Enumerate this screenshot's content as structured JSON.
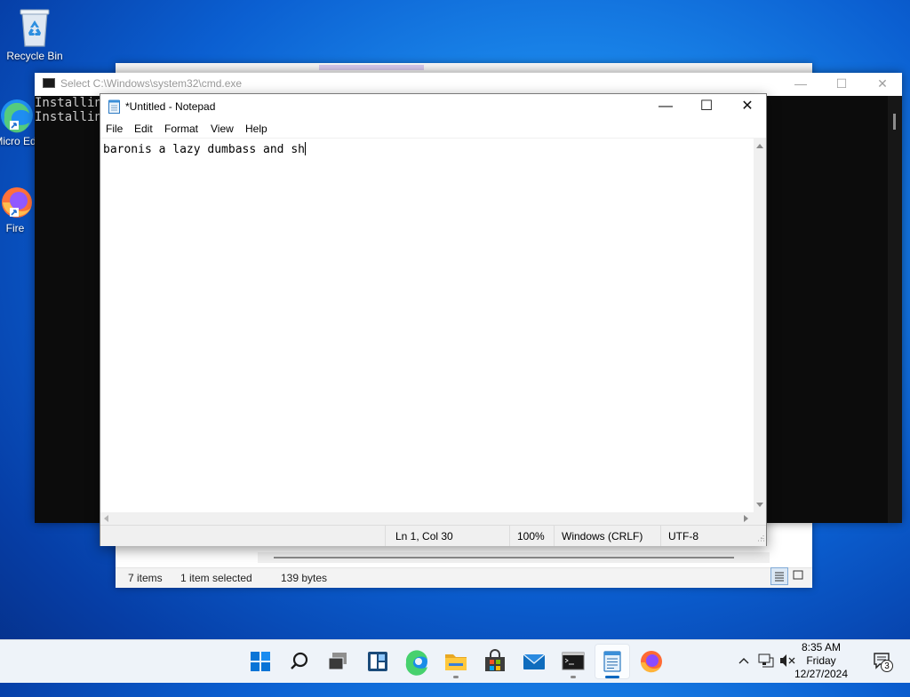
{
  "desktop": {
    "icons": [
      {
        "label": "Recycle Bin",
        "icon": "recycle-bin-icon"
      },
      {
        "label": "Micro Ed",
        "icon": "edge-shortcut-icon"
      },
      {
        "label": "Fire",
        "icon": "firefox-shortcut-icon"
      }
    ]
  },
  "explorer": {
    "status_items": "7 items",
    "status_selected": "1 item selected",
    "status_size": "139 bytes"
  },
  "cmd": {
    "title": "Select C:\\Windows\\system32\\cmd.exe",
    "lines": [
      "Installin",
      "Installin"
    ]
  },
  "notepad": {
    "title": "*Untitled - Notepad",
    "menu": [
      "File",
      "Edit",
      "Format",
      "View",
      "Help"
    ],
    "content": "baronis a lazy dumbass and sh",
    "status": {
      "position": "Ln 1, Col 30",
      "zoom": "100%",
      "line_ending": "Windows (CRLF)",
      "encoding": "UTF-8"
    }
  },
  "taskbar": {
    "apps": [
      "start",
      "search",
      "task-view",
      "widgets",
      "edge",
      "file-explorer",
      "store",
      "mail",
      "terminal",
      "notepad",
      "firefox"
    ],
    "active_app": "notepad",
    "clock": {
      "time": "8:35 AM",
      "day": "Friday",
      "date": "12/27/2024"
    },
    "notification_count": "3"
  },
  "colors": {
    "accent": "#0067c0",
    "desktop": "#0b5fd1",
    "console_bg": "#0c0c0c"
  }
}
